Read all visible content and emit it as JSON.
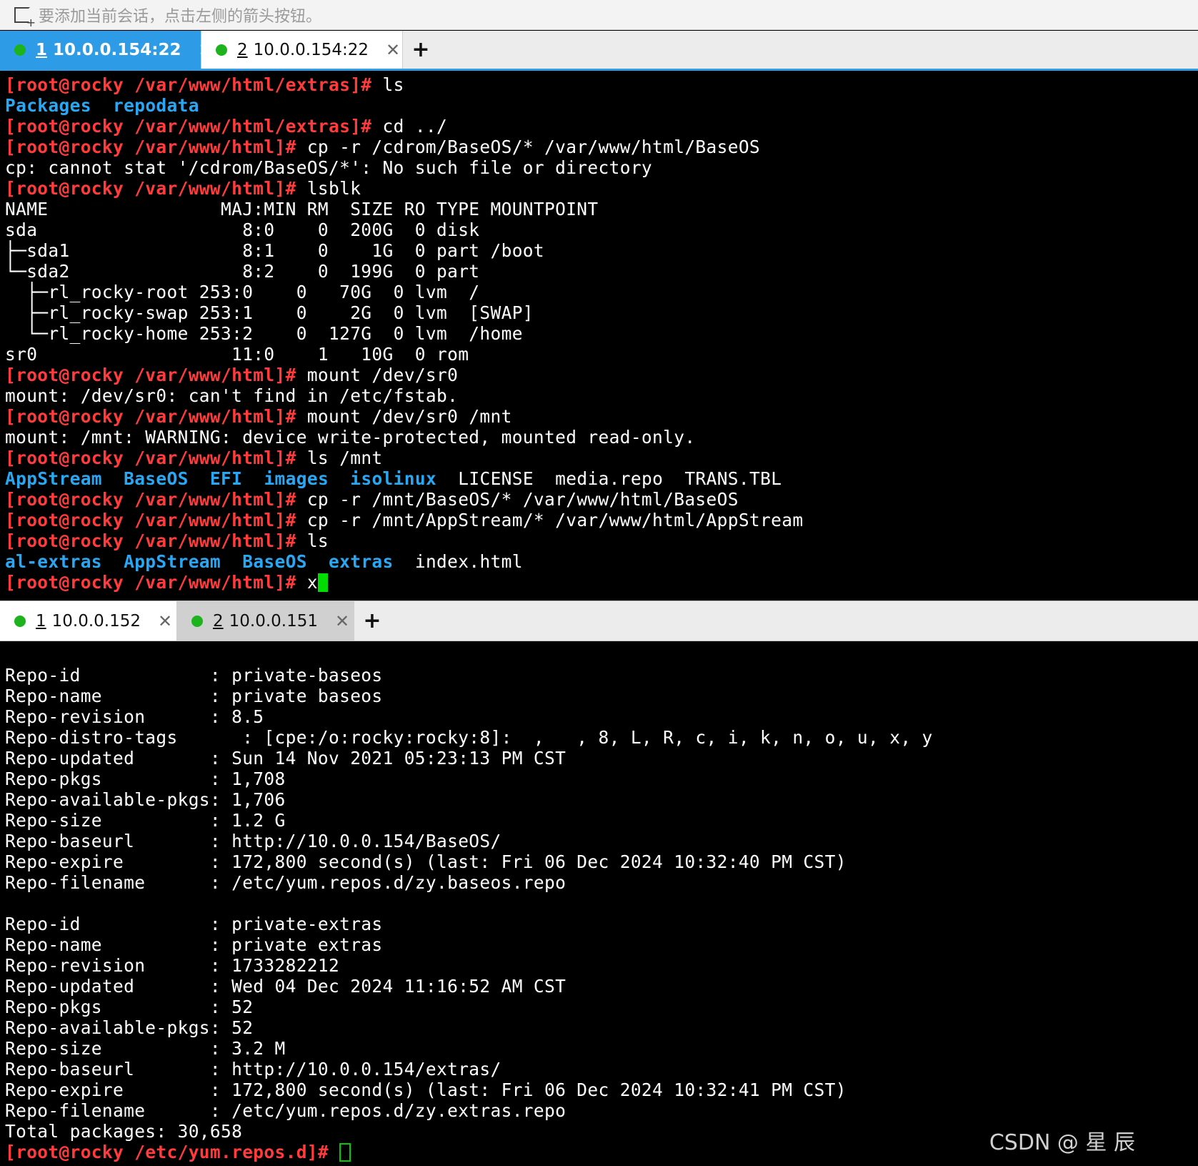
{
  "hint": "要添加当前会话，点击左侧的箭头按钮。",
  "top_tabs": [
    {
      "num": "1",
      "title": "10.0.0.154:22",
      "close": "✕"
    },
    {
      "num": "2",
      "title": "10.0.0.154:22",
      "close": "✕"
    }
  ],
  "bottom_tabs": [
    {
      "num": "1",
      "title": "10.0.0.152",
      "close": "✕"
    },
    {
      "num": "2",
      "title": "10.0.0.151",
      "close": "✕"
    }
  ],
  "add_tab": "+",
  "prompts": {
    "extras": "[root@rocky /var/www/html/extras]#",
    "html": "[root@rocky /var/www/html]#",
    "yum": "[root@rocky /etc/yum.repos.d]#"
  },
  "top_terminal": {
    "cmd_ls": " ls",
    "ls_extras": [
      "Packages",
      "repodata"
    ],
    "cmd_cd": " cd ../",
    "cmd_cp_cdrom": " cp -r /cdrom/BaseOS/* /var/www/html/BaseOS",
    "err_cp": "cp: cannot stat '/cdrom/BaseOS/*': No such file or directory",
    "cmd_lsblk": " lsblk",
    "lsblk": [
      "NAME                MAJ:MIN RM  SIZE RO TYPE MOUNTPOINT",
      "sda                   8:0    0  200G  0 disk",
      "├─sda1                8:1    0    1G  0 part /boot",
      "└─sda2                8:2    0  199G  0 part",
      "  ├─rl_rocky-root 253:0    0   70G  0 lvm  /",
      "  ├─rl_rocky-swap 253:1    0    2G  0 lvm  [SWAP]",
      "  └─rl_rocky-home 253:2    0  127G  0 lvm  /home",
      "sr0                  11:0    1   10G  0 rom"
    ],
    "cmd_mount1": " mount /dev/sr0",
    "out_mount1": "mount: /dev/sr0: can't find in /etc/fstab.",
    "cmd_mount2": " mount /dev/sr0 /mnt",
    "out_mount2": "mount: /mnt: WARNING: device write-protected, mounted read-only.",
    "cmd_ls_mnt": " ls /mnt",
    "ls_mnt_dirs": [
      "AppStream",
      "BaseOS",
      "EFI",
      "images",
      "isolinux"
    ],
    "ls_mnt_files": [
      "LICENSE",
      "media.repo",
      "TRANS.TBL"
    ],
    "cmd_cp_baseos": " cp -r /mnt/BaseOS/* /var/www/html/BaseOS",
    "cmd_cp_appstream": " cp -r /mnt/AppStream/* /var/www/html/AppStream",
    "cmd_ls2": " ls",
    "ls_html_dirs": [
      "al-extras",
      "AppStream",
      "BaseOS",
      "extras"
    ],
    "ls_html_files": [
      "index.html"
    ],
    "typed": " x"
  },
  "bottom_terminal": {
    "lines": [
      "Repo-id            : private-baseos",
      "Repo-name          : private baseos",
      "Repo-revision      : 8.5",
      "Repo-distro-tags      : [cpe:/o:rocky:rocky:8]:  ,   , 8, L, R, c, i, k, n, o, u, x, y",
      "Repo-updated       : Sun 14 Nov 2021 05:23:13 PM CST",
      "Repo-pkgs          : 1,708",
      "Repo-available-pkgs: 1,706",
      "Repo-size          : 1.2 G",
      "Repo-baseurl       : http://10.0.0.154/BaseOS/",
      "Repo-expire        : 172,800 second(s) (last: Fri 06 Dec 2024 10:32:40 PM CST)",
      "Repo-filename      : /etc/yum.repos.d/zy.baseos.repo",
      "",
      "Repo-id            : private-extras",
      "Repo-name          : private extras",
      "Repo-revision      : 1733282212",
      "Repo-updated       : Wed 04 Dec 2024 11:16:52 AM CST",
      "Repo-pkgs          : 52",
      "Repo-available-pkgs: 52",
      "Repo-size          : 3.2 M",
      "Repo-baseurl       : http://10.0.0.154/extras/",
      "Repo-expire        : 172,800 second(s) (last: Fri 06 Dec 2024 10:32:41 PM CST)",
      "Repo-filename      : /etc/yum.repos.d/zy.extras.repo",
      "Total packages: 30,658"
    ]
  },
  "watermark": "CSDN @ 星  辰",
  "colors": {
    "prompt": "#ff3b3b",
    "directory": "#29a7f3",
    "cursor": "#00dd00",
    "active_tab": "#2e9be6",
    "status_dot": "#1db31d"
  }
}
